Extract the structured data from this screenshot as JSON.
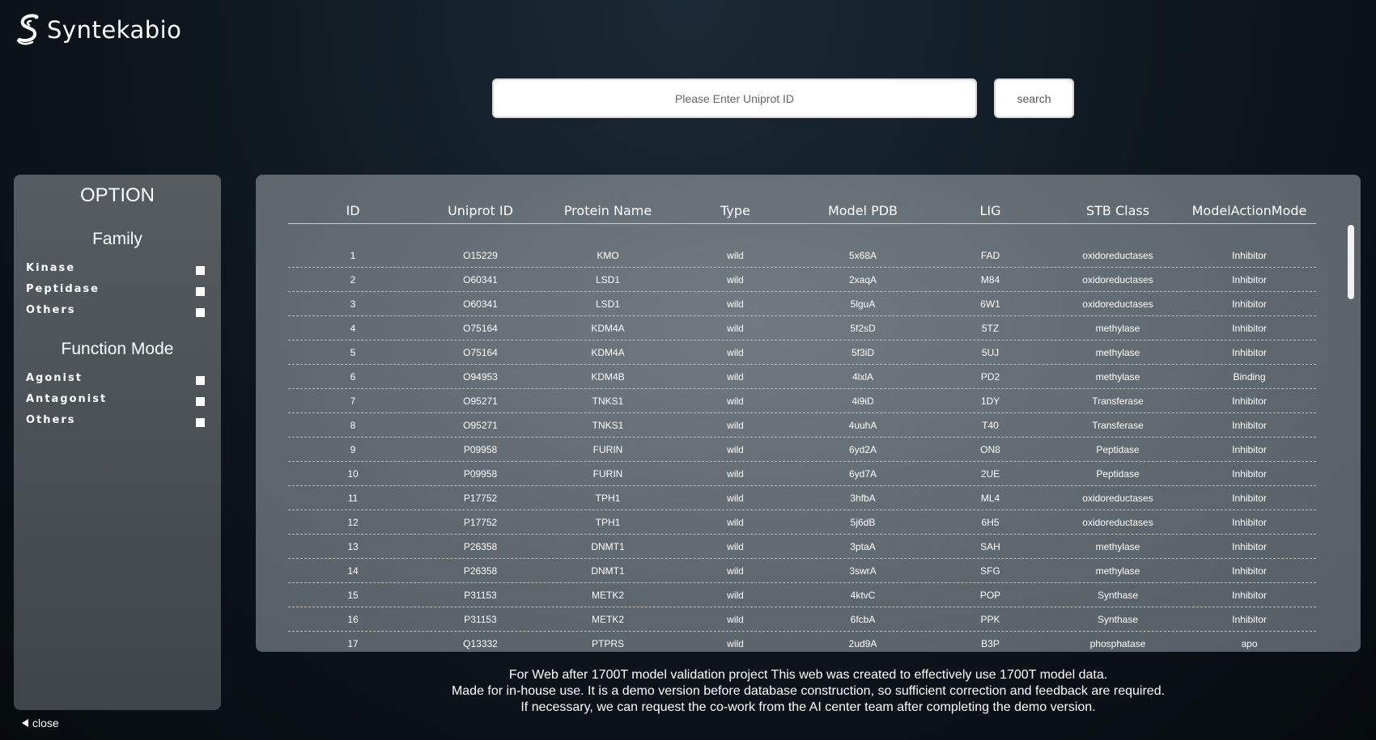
{
  "brand": {
    "name": "Syntekabio",
    "logo_icon": "syntekabio-s-logo"
  },
  "search": {
    "placeholder": "Please Enter Uniprot ID",
    "value": "",
    "button_label": "search"
  },
  "sidebar": {
    "title": "OPTION",
    "family": {
      "title": "Family",
      "options": [
        "Kinase",
        "Peptidase",
        "Others"
      ]
    },
    "function_mode": {
      "title": "Function Mode",
      "options": [
        "Agonist",
        "Antagonist",
        "Others"
      ]
    },
    "close_label": "close"
  },
  "table": {
    "headers": [
      "ID",
      "Uniprot ID",
      "Protein Name",
      "Type",
      "Model PDB",
      "LIG",
      "STB Class",
      "ModelActionMode"
    ],
    "rows": [
      [
        "1",
        "O15229",
        "KMO",
        "wild",
        "5x68A",
        "FAD",
        "oxidoreductases",
        "Inhibitor"
      ],
      [
        "2",
        "O60341",
        "LSD1",
        "wild",
        "2xaqA",
        "M84",
        "oxidoreductases",
        "Inhibitor"
      ],
      [
        "3",
        "O60341",
        "LSD1",
        "wild",
        "5lguA",
        "6W1",
        "oxidoreductases",
        "Inhibitor"
      ],
      [
        "4",
        "O75164",
        "KDM4A",
        "wild",
        "5f2sD",
        "5TZ",
        "methylase",
        "Inhibitor"
      ],
      [
        "5",
        "O75164",
        "KDM4A",
        "wild",
        "5f3iD",
        "5UJ",
        "methylase",
        "Inhibitor"
      ],
      [
        "6",
        "O94953",
        "KDM4B",
        "wild",
        "4lxlA",
        "PD2",
        "methylase",
        "Binding"
      ],
      [
        "7",
        "O95271",
        "TNKS1",
        "wild",
        "4i9iD",
        "1DY",
        "Transferase",
        "Inhibitor"
      ],
      [
        "8",
        "O95271",
        "TNKS1",
        "wild",
        "4uuhA",
        "T40",
        "Transferase",
        "Inhibitor"
      ],
      [
        "9",
        "P09958",
        "FURIN",
        "wild",
        "6yd2A",
        "ON8",
        "Peptidase",
        "Inhibitor"
      ],
      [
        "10",
        "P09958",
        "FURIN",
        "wild",
        "6yd7A",
        "2UE",
        "Peptidase",
        "Inhibitor"
      ],
      [
        "11",
        "P17752",
        "TPH1",
        "wild",
        "3hfbA",
        "ML4",
        "oxidoreductases",
        "Inhibitor"
      ],
      [
        "12",
        "P17752",
        "TPH1",
        "wild",
        "5j6dB",
        "6H5",
        "oxidoreductases",
        "Inhibitor"
      ],
      [
        "13",
        "P26358",
        "DNMT1",
        "wild",
        "3ptaA",
        "SAH",
        "methylase",
        "Inhibitor"
      ],
      [
        "14",
        "P26358",
        "DNMT1",
        "wild",
        "3swrA",
        "SFG",
        "methylase",
        "Inhibitor"
      ],
      [
        "15",
        "P31153",
        "METK2",
        "wild",
        "4ktvC",
        "POP",
        "Synthase",
        "Inhibitor"
      ],
      [
        "16",
        "P31153",
        "METK2",
        "wild",
        "6fcbA",
        "PPK",
        "Synthase",
        "Inhibitor"
      ],
      [
        "17",
        "Q13332",
        "PTPRS",
        "wild",
        "2ud9A",
        "B3P",
        "phosphatase",
        "apo"
      ]
    ]
  },
  "footer": {
    "line1": "For Web after 1700T model validation project This web was created to effectively use 1700T model data.",
    "line2": "Made for in-house use. It is a demo version before database construction, so sufficient correction and feedback are required.",
    "line3": "If necessary, we can request the co-work from the AI center team after completing the demo version."
  },
  "colors": {
    "background": "#0d161d",
    "panel": "#5e676d",
    "text": "#ffffff"
  }
}
